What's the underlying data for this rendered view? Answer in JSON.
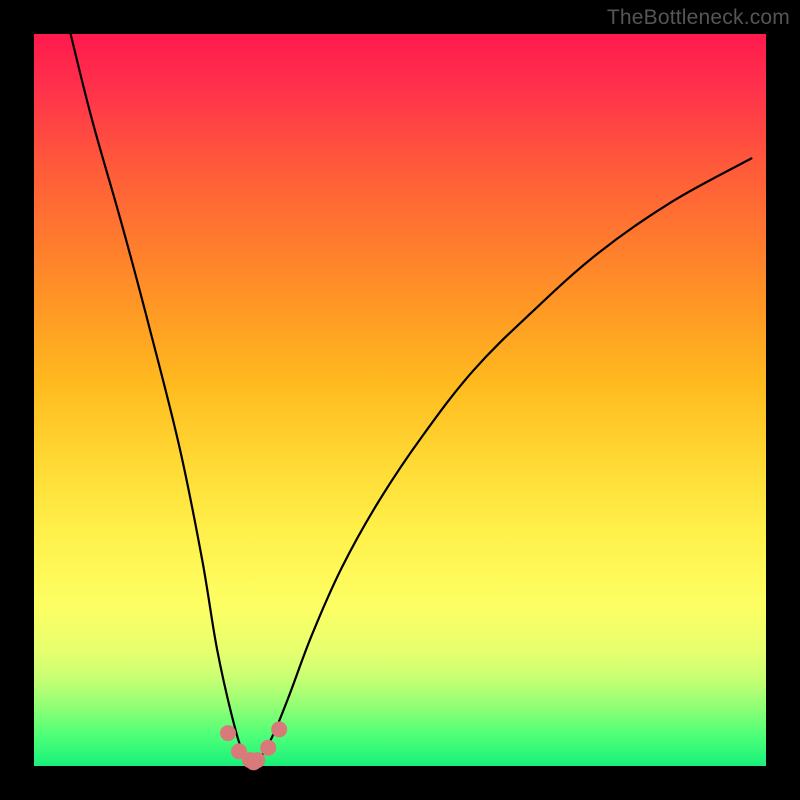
{
  "watermark": "TheBottleneck.com",
  "chart_data": {
    "type": "line",
    "title": "",
    "xlabel": "",
    "ylabel": "",
    "xlim": [
      0,
      100
    ],
    "ylim": [
      0,
      100
    ],
    "series": [
      {
        "name": "bottleneck-curve",
        "x": [
          5,
          8,
          12,
          16,
          20,
          23,
          25,
          27,
          28.5,
          30,
          31.5,
          33,
          35,
          38,
          42,
          47,
          53,
          60,
          68,
          77,
          87,
          98
        ],
        "values": [
          100,
          88,
          74,
          59,
          43,
          28,
          16,
          7,
          2,
          0.5,
          2,
          5,
          10,
          18,
          27,
          36,
          45,
          54,
          62,
          70,
          77,
          83
        ]
      }
    ],
    "markers": {
      "name": "highlight-points",
      "color": "#d97a7a",
      "x": [
        26.5,
        28.0,
        29.5,
        30.0,
        30.5,
        32.0,
        33.5
      ],
      "values": [
        4.5,
        2.0,
        0.8,
        0.5,
        0.8,
        2.5,
        5.0
      ]
    },
    "background_gradient": {
      "top": "#ff1a4d",
      "bottom": "#18f07a"
    }
  }
}
